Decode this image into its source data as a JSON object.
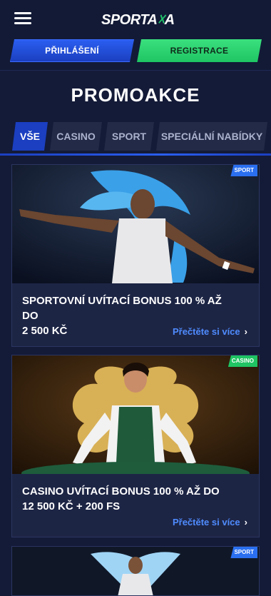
{
  "header": {
    "logo_text": "SPORTA",
    "logo_slash": "☓",
    "logo_end": "A",
    "login_label": "PŘIHLÁŠENÍ",
    "register_label": "REGISTRACE"
  },
  "page": {
    "title": "PROMOAKCE"
  },
  "tabs": [
    {
      "label": "VŠE",
      "active": true
    },
    {
      "label": "CASINO",
      "active": false
    },
    {
      "label": "SPORT",
      "active": false
    },
    {
      "label": "SPECIÁLNÍ NABÍDKY",
      "active": false
    }
  ],
  "promos": [
    {
      "badge": "SPORT",
      "title_line1": "SPORTOVNÍ UVÍTACÍ BONUS 100 % AŽ DO",
      "title_line2": "2 500 KČ",
      "link": "Přečtěte si více"
    },
    {
      "badge": "CASINO",
      "title_line1": "CASINO UVÍTACÍ BONUS 100 % AŽ DO",
      "title_line2": "12 500 KČ + 200 FS",
      "link": "Přečtěte si více"
    },
    {
      "badge": "SPORT"
    }
  ],
  "colors": {
    "primary_blue": "#1b3fc0",
    "accent_green": "#1fc463",
    "link_blue": "#4f8cff",
    "bg": "#141b38"
  }
}
